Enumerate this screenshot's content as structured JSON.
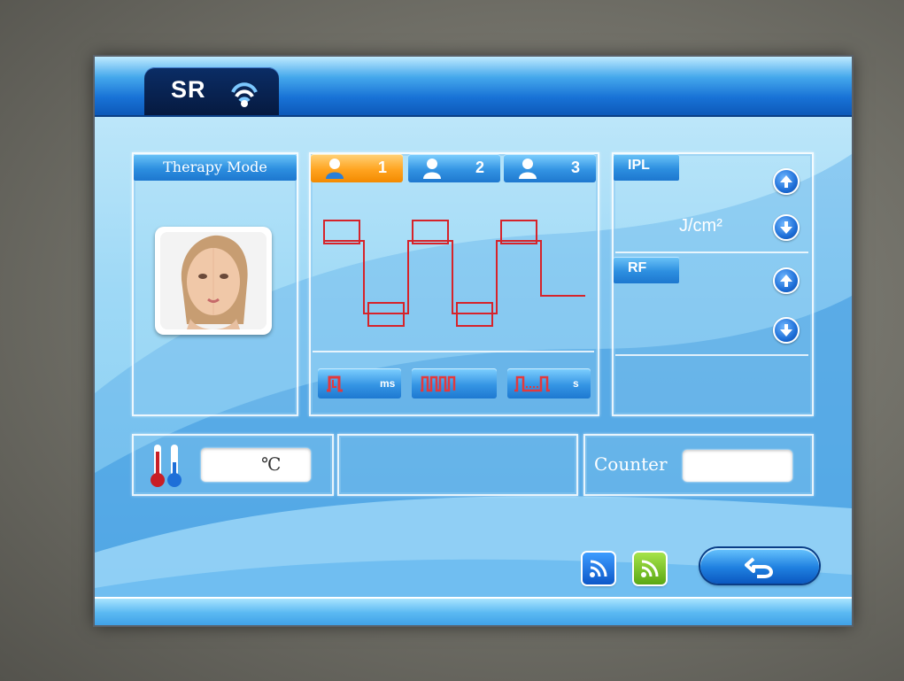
{
  "header": {
    "title": "SR",
    "logo_icon": "signal-wave-icon"
  },
  "therapy": {
    "heading": "Therapy Mode"
  },
  "user_tabs": [
    {
      "label": "1",
      "active": true
    },
    {
      "label": "2",
      "active": false
    },
    {
      "label": "3",
      "active": false
    }
  ],
  "mode_buttons": [
    {
      "icon": "single-pulse-icon",
      "unit": "ms"
    },
    {
      "icon": "pulse-train-icon",
      "unit": ""
    },
    {
      "icon": "pulse-interval-icon",
      "unit": "s"
    }
  ],
  "ipl": {
    "label": "IPL",
    "unit": "J/cm²"
  },
  "rf": {
    "label": "RF"
  },
  "status": {
    "temperature_unit": "℃",
    "counter_label": "Counter"
  },
  "footer": {
    "rss_blue_icon": "rss-icon",
    "rss_green_icon": "rss-icon",
    "back_icon": "back-arrow-icon"
  },
  "colors": {
    "accent_blue": "#1872d6",
    "active_tab": "#f7a01a",
    "waveform": "#d6232a",
    "rss_green": "#7cc41f"
  }
}
